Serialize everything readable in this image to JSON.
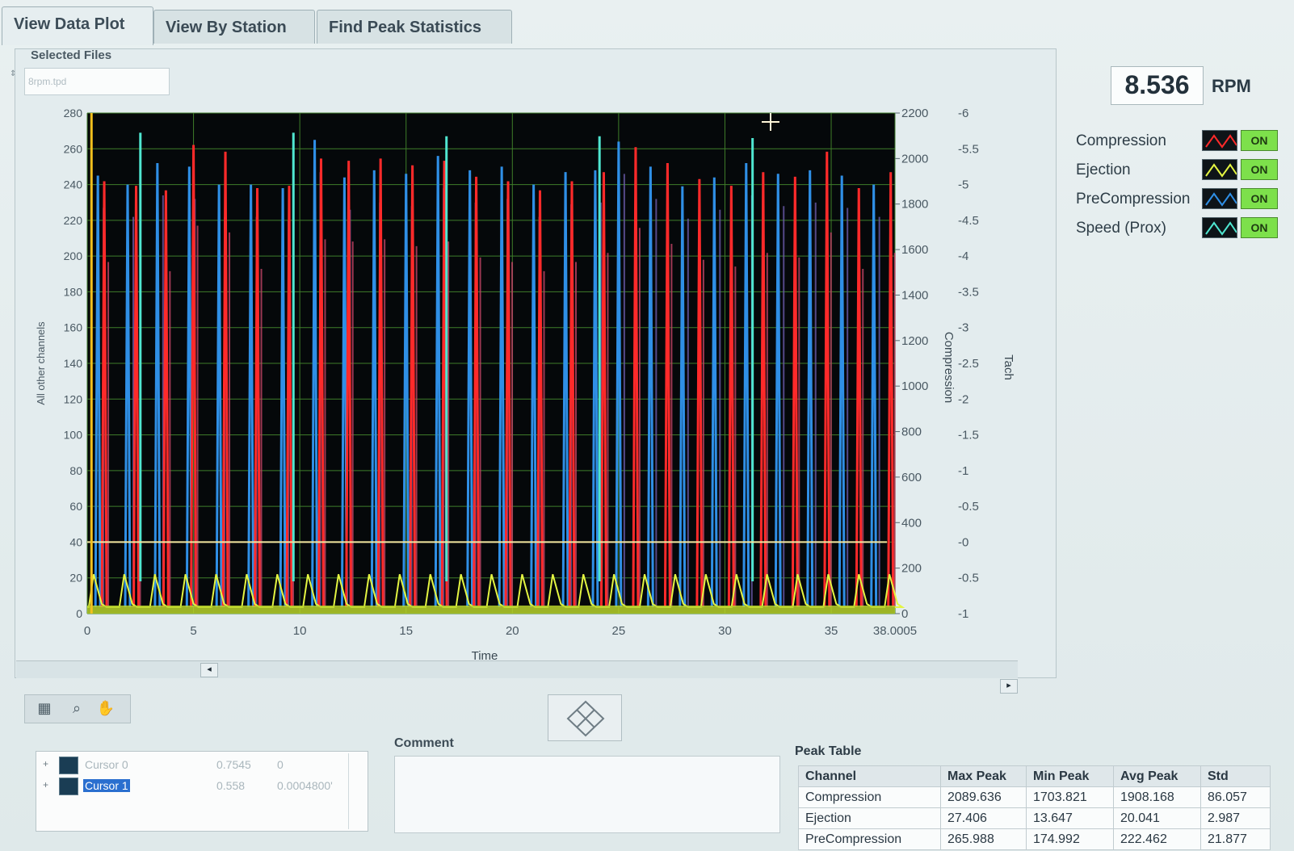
{
  "tabs": [
    {
      "label": "View Data Plot",
      "active": true
    },
    {
      "label": "View By Station",
      "active": false
    },
    {
      "label": "Find Peak Statistics",
      "active": false
    }
  ],
  "selected_files": {
    "label": "Selected Files",
    "value": "8rpm.tpd"
  },
  "rpm": {
    "value": "8.536",
    "unit": "RPM"
  },
  "legend": [
    {
      "name": "Compression",
      "color": "#ff2a2a",
      "state": "ON"
    },
    {
      "name": "Ejection",
      "color": "#e4f542",
      "state": "ON"
    },
    {
      "name": "PreCompression",
      "color": "#2f8fe6",
      "state": "ON"
    },
    {
      "name": "Speed (Prox)",
      "color": "#4fe6d0",
      "state": "ON"
    }
  ],
  "chart_data": {
    "type": "line",
    "xlabel": "Time",
    "ylabel_left": "All other channels",
    "ylabel_right1": "Compression",
    "ylabel_right2": "Tach",
    "x_ticks": [
      "0",
      "5",
      "10",
      "15",
      "20",
      "25",
      "30",
      "35",
      "38.0005"
    ],
    "xlim": [
      0,
      38.0005
    ],
    "y_left_ticks": [
      "0",
      "20",
      "40",
      "60",
      "80",
      "100",
      "120",
      "140",
      "160",
      "180",
      "200",
      "220",
      "240",
      "260",
      "280"
    ],
    "ylim_left": [
      0,
      280
    ],
    "y_right1_ticks": [
      "0",
      "200",
      "400",
      "600",
      "800",
      "1000",
      "1200",
      "1400",
      "1600",
      "1800",
      "2000",
      "2200"
    ],
    "ylim_right1": [
      0,
      2200
    ],
    "y_right2_ticks": [
      "-1",
      "-0.5",
      "-0",
      "-0.5",
      "-1",
      "-1.5",
      "-2",
      "-2.5",
      "-3",
      "-3.5",
      "-4",
      "-4.5",
      "-5",
      "-5.5",
      "-6"
    ],
    "grid": true,
    "cursor_level_left": 40,
    "series": [
      {
        "name": "Compression",
        "color": "#ff2a2a",
        "peak_times": [
          0.8,
          2.3,
          3.7,
          5.0,
          6.5,
          8.0,
          9.5,
          11.0,
          12.3,
          13.8,
          15.3,
          16.8,
          18.3,
          19.8,
          21.3,
          22.8,
          24.3,
          25.8,
          27.3,
          28.8,
          30.3,
          31.8,
          33.3,
          34.8,
          36.3,
          37.8
        ],
        "peak_values": [
          1900,
          1880,
          1860,
          2060,
          2030,
          1870,
          1880,
          2000,
          1990,
          2000,
          1970,
          1990,
          1920,
          1900,
          1860,
          1900,
          1940,
          2050,
          1980,
          1910,
          1880,
          1940,
          1920,
          2030,
          1870,
          1940
        ]
      },
      {
        "name": "PreCompression",
        "color": "#2f8fe6",
        "peak_times": [
          0.5,
          1.9,
          3.3,
          4.8,
          6.2,
          7.7,
          9.2,
          10.7,
          12.1,
          13.5,
          15.0,
          16.5,
          18.0,
          19.5,
          21.0,
          22.5,
          23.9,
          25.0,
          26.5,
          28.0,
          29.5,
          31.0,
          32.5,
          34.0,
          35.5,
          37.0
        ],
        "peak_values": [
          245,
          240,
          252,
          250,
          240,
          240,
          238,
          265,
          244,
          248,
          246,
          256,
          248,
          250,
          240,
          247,
          248,
          264,
          250,
          239,
          244,
          252,
          246,
          248,
          245,
          240
        ]
      },
      {
        "name": "Speed (Prox)",
        "color": "#4fe6d0",
        "peak_times": [
          2.5,
          9.7,
          16.9,
          24.1,
          31.3
        ],
        "peak_values": [
          269,
          269,
          267,
          267,
          266
        ]
      },
      {
        "name": "Ejection",
        "color": "#e4f542",
        "peak_values_approx": 22
      }
    ]
  },
  "cursors": [
    {
      "name": "Cursor 0",
      "x": "0.7545",
      "y": "0",
      "selected": false
    },
    {
      "name": "Cursor 1",
      "x": "0.558",
      "y": "0.0004800'",
      "selected": true
    }
  ],
  "comment": {
    "label": "Comment",
    "value": ""
  },
  "peak_table": {
    "title": "Peak Table",
    "columns": [
      "Channel",
      "Max Peak",
      "Min Peak",
      "Avg Peak",
      "Std"
    ],
    "rows": [
      [
        "Compression",
        "2089.636",
        "1703.821",
        "1908.168",
        "86.057"
      ],
      [
        "Ejection",
        "27.406",
        "13.647",
        "20.041",
        "2.987"
      ],
      [
        "PreCompression",
        "265.988",
        "174.992",
        "222.462",
        "21.877"
      ]
    ]
  }
}
